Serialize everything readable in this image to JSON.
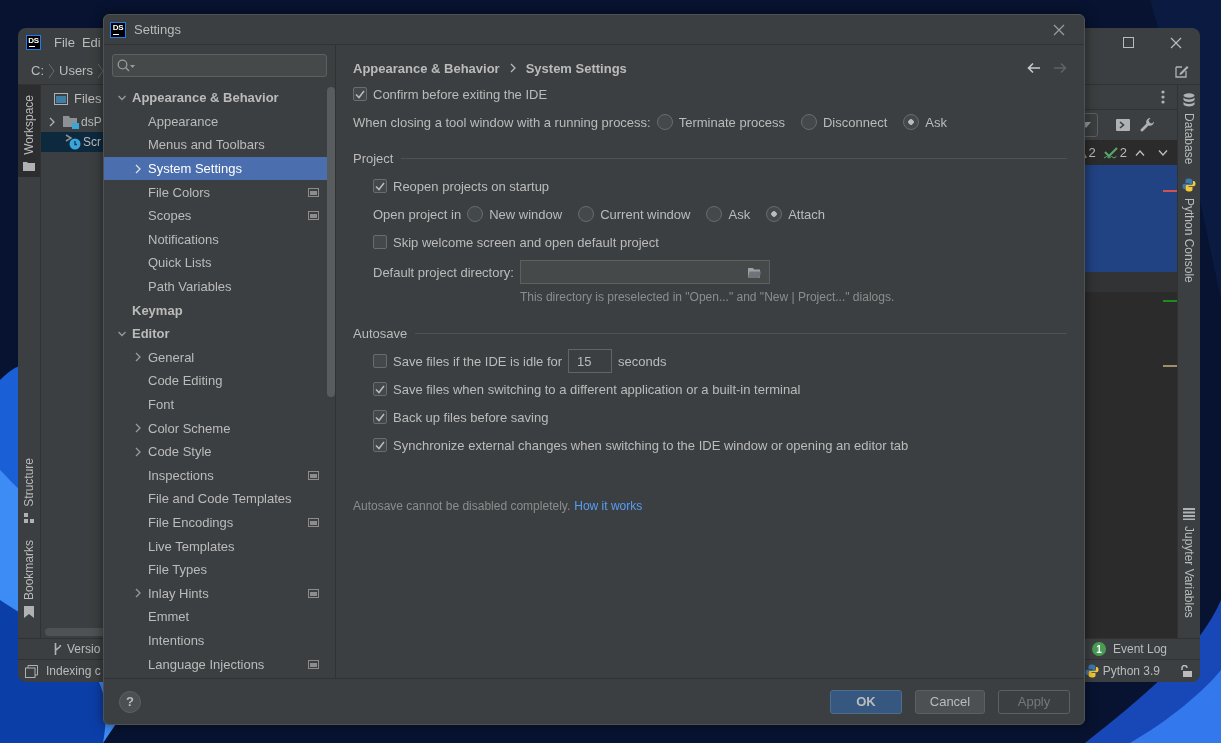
{
  "ide_window": {
    "logo": "DS",
    "menu": [
      "File",
      "Edi"
    ],
    "path": [
      "C:",
      "Users"
    ],
    "left_tools_top": [
      {
        "label": "Workspace",
        "selected": true
      }
    ],
    "left_tools_bottom": [
      {
        "label": "Structure",
        "selected": false
      },
      {
        "label": "Bookmarks",
        "selected": false
      }
    ],
    "files_panel": {
      "title": "Files",
      "tree": [
        {
          "label": "dsP",
          "expanded": false,
          "selected": false
        },
        {
          "label": "Scr",
          "selected": true
        }
      ]
    },
    "inspection_widget": {
      "warnings": "2",
      "typos": "2"
    },
    "right_tools_top": [
      {
        "label": "Database",
        "selected": false
      },
      {
        "label": "Python Console",
        "selected": false
      }
    ],
    "right_tools_bottom": [
      {
        "label": "Jupyter Variables",
        "selected": false
      }
    ],
    "tool_tabs": [
      {
        "label": "Versio"
      }
    ],
    "event_log": {
      "label": "Event Log",
      "count": "1"
    },
    "status_bar": {
      "message": "Indexing c",
      "interpreter": "Python 3.9"
    }
  },
  "dialog": {
    "logo": "DS",
    "title": "Settings",
    "settings_tree": [
      {
        "label": "Appearance & Behavior",
        "expanded": true,
        "selected": false,
        "project_level": false,
        "children": [
          {
            "label": "Appearance",
            "selected": false,
            "project_level": false
          },
          {
            "label": "Menus and Toolbars",
            "selected": false,
            "project_level": false
          },
          {
            "label": "System Settings",
            "expanded": false,
            "selected": true,
            "project_level": false
          },
          {
            "label": "File Colors",
            "selected": false,
            "project_level": true
          },
          {
            "label": "Scopes",
            "selected": false,
            "project_level": true
          },
          {
            "label": "Notifications",
            "selected": false,
            "project_level": false
          },
          {
            "label": "Quick Lists",
            "selected": false,
            "project_level": false
          },
          {
            "label": "Path Variables",
            "selected": false,
            "project_level": false
          }
        ]
      },
      {
        "label": "Keymap",
        "selected": false,
        "project_level": false
      },
      {
        "label": "Editor",
        "expanded": true,
        "selected": false,
        "project_level": false,
        "children": [
          {
            "label": "General",
            "expanded": false,
            "selected": false,
            "project_level": false
          },
          {
            "label": "Code Editing",
            "selected": false,
            "project_level": false
          },
          {
            "label": "Font",
            "selected": false,
            "project_level": false
          },
          {
            "label": "Color Scheme",
            "expanded": false,
            "selected": false,
            "project_level": false
          },
          {
            "label": "Code Style",
            "expanded": false,
            "selected": false,
            "project_level": false
          },
          {
            "label": "Inspections",
            "selected": false,
            "project_level": true
          },
          {
            "label": "File and Code Templates",
            "selected": false,
            "project_level": false
          },
          {
            "label": "File Encodings",
            "selected": false,
            "project_level": true
          },
          {
            "label": "Live Templates",
            "selected": false,
            "project_level": false
          },
          {
            "label": "File Types",
            "selected": false,
            "project_level": false
          },
          {
            "label": "Inlay Hints",
            "expanded": false,
            "selected": false,
            "project_level": true
          },
          {
            "label": "Emmet",
            "selected": false,
            "project_level": false
          },
          {
            "label": "Intentions",
            "selected": false,
            "project_level": false
          },
          {
            "label": "Language Injections",
            "selected": false,
            "project_level": true
          }
        ]
      }
    ],
    "breadcrumb": [
      "Appearance & Behavior",
      "System Settings"
    ],
    "navigation": {
      "back_enabled": true,
      "forward_enabled": false
    },
    "options": [
      {
        "kind": "checkbox",
        "label": "Confirm before exiting the IDE",
        "checked": true
      },
      {
        "kind": "radio_group",
        "label": "When closing a tool window with a running process:",
        "options": [
          {
            "label": "Terminate process",
            "selected": false
          },
          {
            "label": "Disconnect",
            "selected": false
          },
          {
            "label": "Ask",
            "selected": true
          }
        ]
      }
    ],
    "sections": [
      {
        "title": "Project",
        "items": [
          {
            "kind": "checkbox",
            "label": "Reopen projects on startup",
            "checked": true
          },
          {
            "kind": "radio_group",
            "label": "Open project in",
            "options": [
              {
                "label": "New window",
                "selected": false
              },
              {
                "label": "Current window",
                "selected": false
              },
              {
                "label": "Ask",
                "selected": false
              },
              {
                "label": "Attach",
                "selected": true
              }
            ]
          },
          {
            "kind": "checkbox",
            "label": "Skip welcome screen and open default project",
            "checked": false
          },
          {
            "kind": "path_field",
            "label": "Default project directory:",
            "hint": "This directory is preselected in \"Open...\" and \"New | Project...\" dialogs."
          }
        ]
      },
      {
        "title": "Autosave",
        "items": [
          {
            "kind": "timed_checkbox",
            "label": "Save files if the IDE is idle for",
            "checked": false,
            "value": "15",
            "unit": "seconds"
          },
          {
            "kind": "checkbox",
            "label": "Save files when switching to a different application or a built-in terminal",
            "checked": true
          },
          {
            "kind": "checkbox",
            "label": "Back up files before saving",
            "checked": true
          },
          {
            "kind": "checkbox",
            "label": "Synchronize external changes when switching to the IDE window or opening an editor tab",
            "checked": true
          }
        ]
      }
    ],
    "note": {
      "text": "Autosave cannot be disabled completely.",
      "link": "How it works"
    },
    "help": "?",
    "buttons": [
      {
        "label": "OK",
        "default": true,
        "disabled": false
      },
      {
        "label": "Cancel",
        "default": false,
        "disabled": false
      },
      {
        "label": "Apply",
        "default": false,
        "disabled": true
      }
    ]
  }
}
